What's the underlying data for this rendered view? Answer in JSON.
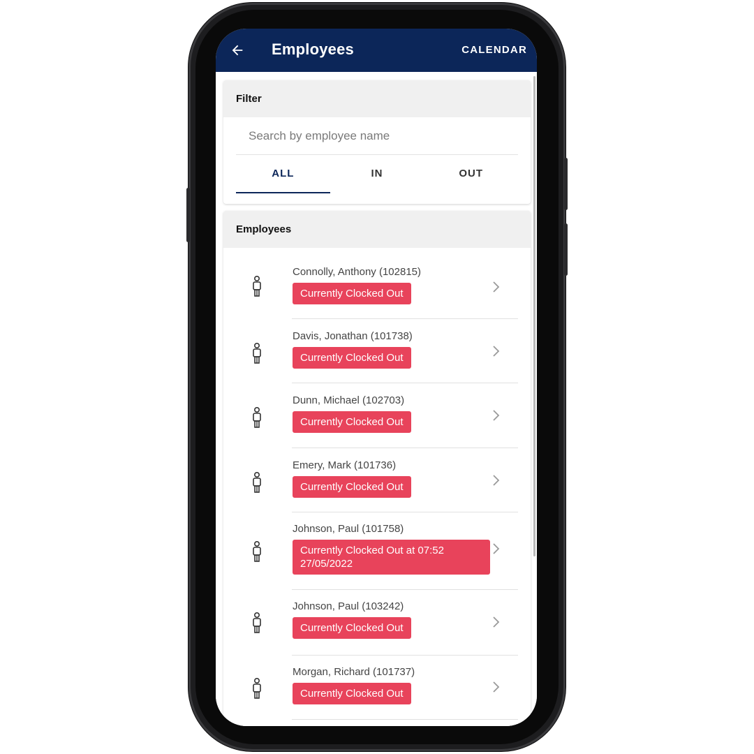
{
  "app_bar": {
    "title": "Employees",
    "action_label": "CALENDAR",
    "color": "#0c2659"
  },
  "filter": {
    "header": "Filter",
    "search_placeholder": "Search by employee name",
    "tabs": [
      {
        "label": "ALL",
        "active": true
      },
      {
        "label": "IN",
        "active": false
      },
      {
        "label": "OUT",
        "active": false
      }
    ]
  },
  "employees_section": {
    "header": "Employees",
    "badge_color": "#e8435b",
    "items": [
      {
        "name": "Connolly, Anthony (102815)",
        "status": "Currently Clocked Out"
      },
      {
        "name": "Davis, Jonathan (101738)",
        "status": "Currently Clocked Out"
      },
      {
        "name": "Dunn, Michael (102703)",
        "status": "Currently Clocked Out"
      },
      {
        "name": "Emery, Mark (101736)",
        "status": "Currently Clocked Out"
      },
      {
        "name": "Johnson, Paul (101758)",
        "status": "Currently Clocked Out at 07:52\n27/05/2022"
      },
      {
        "name": "Johnson, Paul (103242)",
        "status": "Currently Clocked Out"
      },
      {
        "name": "Morgan, Richard (101737)",
        "status": "Currently Clocked Out"
      }
    ]
  },
  "icons": {
    "back": "arrow-left-icon",
    "person": "person-icon",
    "chevron": "chevron-right-icon"
  }
}
